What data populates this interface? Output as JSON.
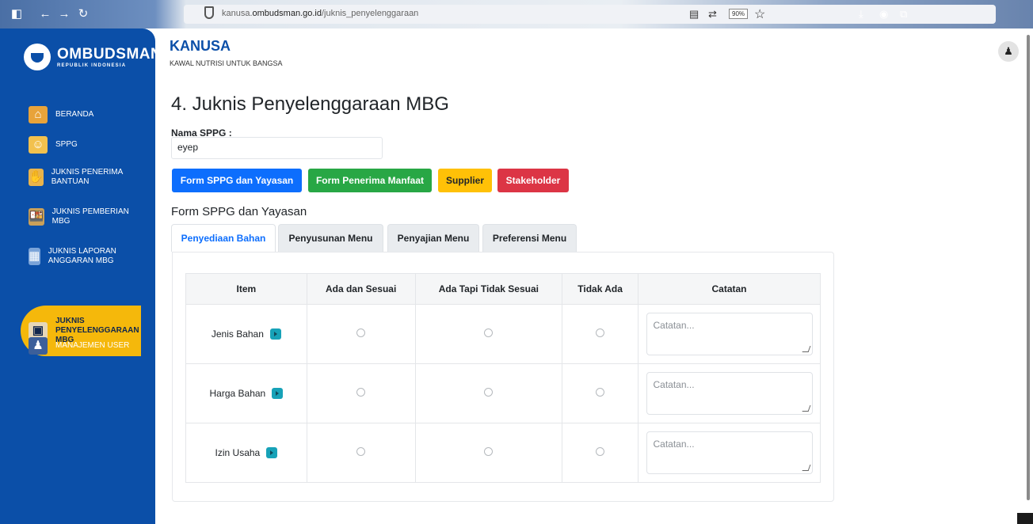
{
  "browser": {
    "url_prefix": "kanusa.",
    "url_domain": "ombudsman.go.id",
    "url_path": "/juknis_penyelenggaraan",
    "zoom": "90%"
  },
  "sidebar": {
    "logo_title": "OMBUDSMAN",
    "logo_subtitle": "REPUBLIK INDONESIA",
    "items": [
      {
        "label": "BERANDA"
      },
      {
        "label": "SPPG"
      },
      {
        "label": "JUKNIS PENERIMA BANTUAN"
      },
      {
        "label": "JUKNIS PEMBERIAN MBG"
      },
      {
        "label": "JUKNIS LAPORAN ANGGARAN MBG"
      },
      {
        "label": "JUKNIS PENYELENGGARAAN MBG"
      },
      {
        "label": "MANAJEMEN USER"
      }
    ]
  },
  "header": {
    "app_title": "KANUSA",
    "app_subtitle": "KAWAL NUTRISI UNTUK BANGSA"
  },
  "main": {
    "page_title": "4. Juknis Penyelenggaraan MBG",
    "nama_label": "Nama SPPG :",
    "nama_value": "eyep",
    "buttons": [
      {
        "label": "Form SPPG dan Yayasan",
        "color": "#0d6efd"
      },
      {
        "label": "Form Penerima Manfaat",
        "color": "#28a745"
      },
      {
        "label": "Supplier",
        "color": "#ffc107"
      },
      {
        "label": "Stakeholder",
        "color": "#dc3545"
      }
    ],
    "section_title": "Form SPPG dan Yayasan",
    "tabs": [
      {
        "label": "Penyediaan Bahan",
        "active": true
      },
      {
        "label": "Penyusunan Menu",
        "active": false
      },
      {
        "label": "Penyajian Menu",
        "active": false
      },
      {
        "label": "Preferensi Menu",
        "active": false
      }
    ],
    "table": {
      "headers": [
        "Item",
        "Ada dan Sesuai",
        "Ada Tapi Tidak Sesuai",
        "Tidak Ada",
        "Catatan"
      ],
      "rows": [
        {
          "item": "Jenis Bahan",
          "notes_placeholder": "Catatan..."
        },
        {
          "item": "Harga Bahan",
          "notes_placeholder": "Catatan..."
        },
        {
          "item": "Izin Usaha",
          "notes_placeholder": "Catatan..."
        }
      ]
    }
  }
}
